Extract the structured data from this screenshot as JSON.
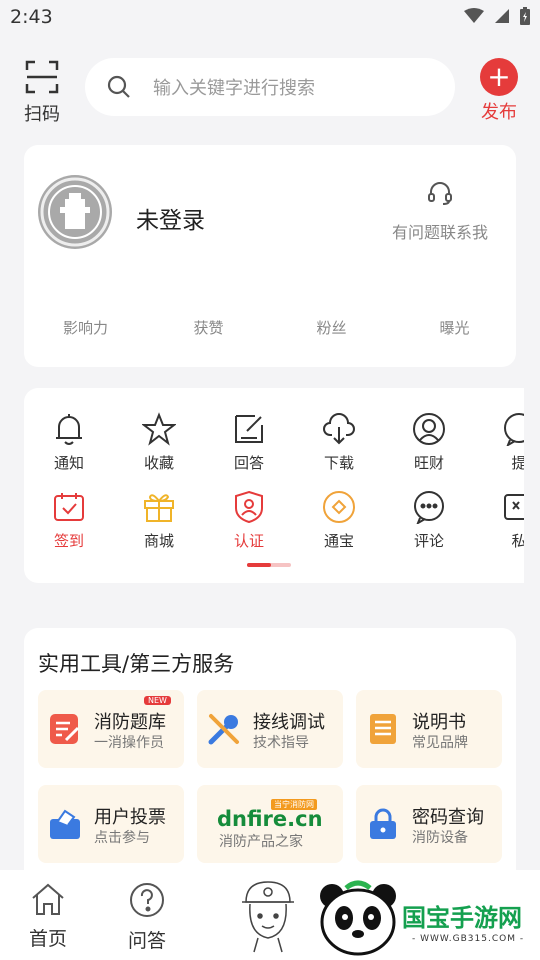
{
  "status_bar": {
    "time": "2:43"
  },
  "top_bar": {
    "scan_label": "扫码",
    "search_placeholder": "输入关键字进行搜索",
    "publish_label": "发布"
  },
  "profile": {
    "login_status": "未登录",
    "contact_label": "有问题联系我",
    "stats": [
      "影响力",
      "获赞",
      "粉丝",
      "曝光"
    ]
  },
  "menu": {
    "row1": [
      {
        "label": "通知",
        "icon": "bell-icon"
      },
      {
        "label": "收藏",
        "icon": "star-icon"
      },
      {
        "label": "回答",
        "icon": "edit-icon"
      },
      {
        "label": "下载",
        "icon": "cloud-download-icon"
      },
      {
        "label": "旺财",
        "icon": "person-icon"
      },
      {
        "label": "提",
        "icon": "chat-icon"
      }
    ],
    "row2": [
      {
        "label": "签到",
        "icon": "calendar-check-icon"
      },
      {
        "label": "商城",
        "icon": "gift-icon"
      },
      {
        "label": "认证",
        "icon": "shield-user-icon"
      },
      {
        "label": "通宝",
        "icon": "coin-icon"
      },
      {
        "label": "评论",
        "icon": "comment-icon"
      },
      {
        "label": "私",
        "icon": "message-icon"
      }
    ]
  },
  "tools": {
    "title": "实用工具/第三方服务",
    "items": [
      {
        "name": "消防题库",
        "sub": "一消操作员",
        "badge": "NEW"
      },
      {
        "name": "接线调试",
        "sub": "技术指导"
      },
      {
        "name": "说明书",
        "sub": "常见品牌"
      },
      {
        "name": "用户投票",
        "sub": "点击参与"
      },
      {
        "name": "dnfire.cn",
        "sub": "消防产品之家",
        "tag": "当宁消防网"
      },
      {
        "name": "密码查询",
        "sub": "消防设备"
      }
    ]
  },
  "bottom_nav": {
    "home": "首页",
    "qa": "问答"
  },
  "watermark": {
    "brand": "国宝手游网",
    "url": "- WWW.GB315.COM -"
  },
  "colors": {
    "accent": "#e53b3b",
    "tool_bg": "#fdf6ea",
    "blue_icon": "#3b7ae0",
    "orange_icon": "#f0a33a"
  }
}
